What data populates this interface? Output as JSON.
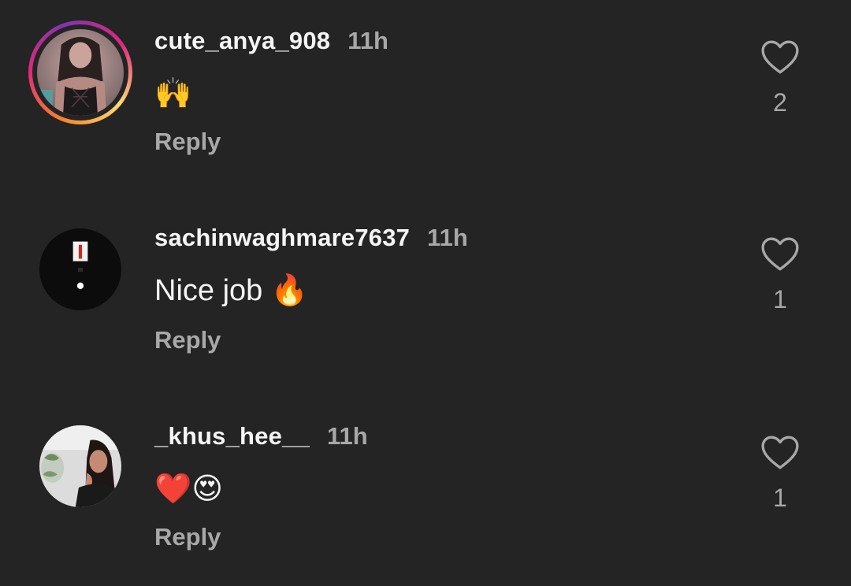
{
  "comments": [
    {
      "username": "cute_anya_908",
      "time": "11h",
      "text": "🙌",
      "reply_label": "Reply",
      "likes": "2",
      "avatar": {
        "type": "photo",
        "story_ring": true
      }
    },
    {
      "username": "sachinwaghmare7637",
      "time": "11h",
      "text": "Nice job 🔥",
      "reply_label": "Reply",
      "likes": "1",
      "avatar": {
        "type": "dark-logo",
        "story_ring": false
      }
    },
    {
      "username": "_khus_hee__",
      "time": "11h",
      "text": "❤️😍",
      "reply_label": "Reply",
      "likes": "1",
      "avatar": {
        "type": "photo",
        "story_ring": false
      }
    }
  ],
  "colors": {
    "background": "#242424",
    "primary_text": "#f5f5f5",
    "secondary_text": "#a8a8a8"
  },
  "icons": {
    "like": "heart-outline-icon"
  }
}
